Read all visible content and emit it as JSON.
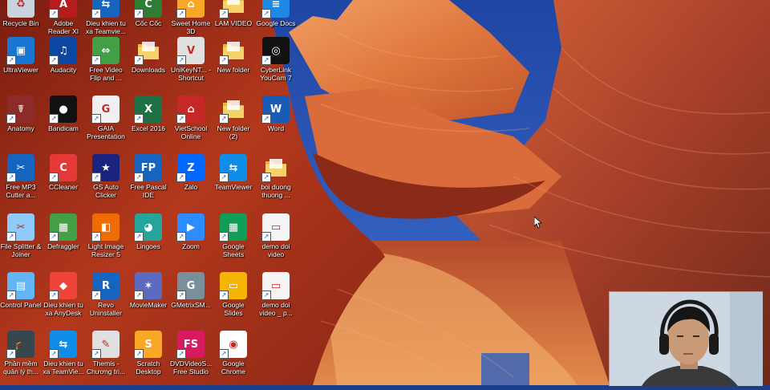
{
  "desktop": {
    "icons": [
      {
        "label": "Recycle Bin",
        "icon": "recycle-bin-icon",
        "color": "#c8d3df",
        "glyph": "♻"
      },
      {
        "label": "Adobe Reader XI",
        "icon": "adobe-reader-icon",
        "color": "#b71c1c",
        "glyph": "A"
      },
      {
        "label": "Dieu khien tu xa Teamvie...",
        "icon": "teamviewer-icon",
        "color": "#1565c0",
        "glyph": "⇆"
      },
      {
        "label": "Cốc Cốc",
        "icon": "coccoc-icon",
        "color": "#2e7d32",
        "glyph": "C"
      },
      {
        "label": "Sweet Home 3D",
        "icon": "sweet-home-icon",
        "color": "#f9a825",
        "glyph": "⌂"
      },
      {
        "label": "LAM VIDEO",
        "icon": "folder-icon",
        "color": "#f2c94c",
        "glyph": ""
      },
      {
        "label": "Google Docs",
        "icon": "google-docs-icon",
        "color": "#1e88e5",
        "glyph": "≡"
      },
      {
        "label": "UltraViewer",
        "icon": "ultraviewer-icon",
        "color": "#1976d2",
        "glyph": "▣"
      },
      {
        "label": "Audacity",
        "icon": "audacity-icon",
        "color": "#0d47a1",
        "glyph": "♫"
      },
      {
        "label": "Free Video Flip and ...",
        "icon": "video-flip-icon",
        "color": "#43a047",
        "glyph": "⇔"
      },
      {
        "label": "Downloads",
        "icon": "downloads-folder-icon",
        "color": "#f2c94c",
        "glyph": ""
      },
      {
        "label": "UniKeyNT... - Shortcut",
        "icon": "unikey-icon",
        "color": "#e0e0e0",
        "glyph": "V"
      },
      {
        "label": "New folder",
        "icon": "folder-icon",
        "color": "#f2c94c",
        "glyph": ""
      },
      {
        "label": "CyberLink YouCam 7",
        "icon": "youcam-icon",
        "color": "#111111",
        "glyph": "◎"
      },
      {
        "label": "Anatomy",
        "icon": "anatomy-icon",
        "color": "#8d2b2b",
        "glyph": "☤"
      },
      {
        "label": "Bandicam",
        "icon": "bandicam-icon",
        "color": "#111111",
        "glyph": "●"
      },
      {
        "label": "GAIA Presentation",
        "icon": "gaia-icon",
        "color": "#f0f0f0",
        "glyph": "G"
      },
      {
        "label": "Excel 2016",
        "icon": "excel-icon",
        "color": "#1e7145",
        "glyph": "X"
      },
      {
        "label": "VietSchool Online",
        "icon": "vietschool-icon",
        "color": "#c62828",
        "glyph": "⌂"
      },
      {
        "label": "New folder (2)",
        "icon": "folder-icon",
        "color": "#f2c94c",
        "glyph": ""
      },
      {
        "label": "Word",
        "icon": "word-icon",
        "color": "#1a5bb5",
        "glyph": "W"
      },
      {
        "label": "Free MP3 Cutter a...",
        "icon": "mp3-cutter-icon",
        "color": "#1565c0",
        "glyph": "✂"
      },
      {
        "label": "CCleaner",
        "icon": "ccleaner-icon",
        "color": "#e53935",
        "glyph": "C"
      },
      {
        "label": "GS Auto Clicker",
        "icon": "gs-auto-clicker-icon",
        "color": "#1a237e",
        "glyph": "★"
      },
      {
        "label": "Free Pascal IDE",
        "icon": "free-pascal-icon",
        "color": "#1565c0",
        "glyph": "FP"
      },
      {
        "label": "Zalo",
        "icon": "zalo-icon",
        "color": "#0068ff",
        "glyph": "Z"
      },
      {
        "label": "TeamViewer",
        "icon": "teamviewer-icon",
        "color": "#0e8ee9",
        "glyph": "⇆"
      },
      {
        "label": "boi duong thuong ...",
        "icon": "folder-icon",
        "color": "#f2c94c",
        "glyph": ""
      },
      {
        "label": "File Splitter & Joiner",
        "icon": "file-splitter-icon",
        "color": "#90caf9",
        "glyph": "✂"
      },
      {
        "label": "Defraggler",
        "icon": "defraggler-icon",
        "color": "#43a047",
        "glyph": "▦"
      },
      {
        "label": "Light Image Resizer 5",
        "icon": "image-resizer-icon",
        "color": "#ef6c00",
        "glyph": "◧"
      },
      {
        "label": "Lingoes",
        "icon": "lingoes-icon",
        "color": "#26a69a",
        "glyph": "◕"
      },
      {
        "label": "Zoom",
        "icon": "zoom-icon",
        "color": "#2d8cff",
        "glyph": "▶"
      },
      {
        "label": "Google Sheets",
        "icon": "google-sheets-icon",
        "color": "#0f9d58",
        "glyph": "▦"
      },
      {
        "label": "demo doi video",
        "icon": "video-file-icon",
        "color": "#f5f5f5",
        "glyph": "▭"
      },
      {
        "label": "Control Panel",
        "icon": "control-panel-icon",
        "color": "#64b5f6",
        "glyph": "▤"
      },
      {
        "label": "Dieu khien tu xa AnyDesk",
        "icon": "anydesk-icon",
        "color": "#ef443b",
        "glyph": "◆"
      },
      {
        "label": "Revo Uninstaller",
        "icon": "revo-uninstaller-icon",
        "color": "#1565c0",
        "glyph": "R"
      },
      {
        "label": "MovieMaker",
        "icon": "moviemaker-icon",
        "color": "#5c6bc0",
        "glyph": "✶"
      },
      {
        "label": "GMetrixSM...",
        "icon": "gmetrix-icon",
        "color": "#78909c",
        "glyph": "G"
      },
      {
        "label": "Google Slides",
        "icon": "google-slides-icon",
        "color": "#f4b400",
        "glyph": "▭"
      },
      {
        "label": "demo doi video _ p...",
        "icon": "video-file-icon",
        "color": "#f5f5f5",
        "glyph": "▭"
      },
      {
        "label": "Phần mềm quản lý th...",
        "icon": "school-software-icon",
        "color": "#37474f",
        "glyph": "🎓"
      },
      {
        "label": "Dieu khien tu xa TeamVie...",
        "icon": "teamviewer-icon",
        "color": "#0e8ee9",
        "glyph": "⇆"
      },
      {
        "label": "Themis - Chương tri...",
        "icon": "themis-icon",
        "color": "#e0e0e0",
        "glyph": "✎"
      },
      {
        "label": "Scratch Desktop",
        "icon": "scratch-icon",
        "color": "#f9a825",
        "glyph": "S"
      },
      {
        "label": "DVDVideoS... Free Studio",
        "icon": "dvdvideosoft-icon",
        "color": "#d81b60",
        "glyph": "FS"
      },
      {
        "label": "Google Chrome",
        "icon": "chrome-icon",
        "color": "#ffffff",
        "glyph": "◉"
      }
    ]
  },
  "webcam": {
    "label": "webcam-overlay"
  }
}
